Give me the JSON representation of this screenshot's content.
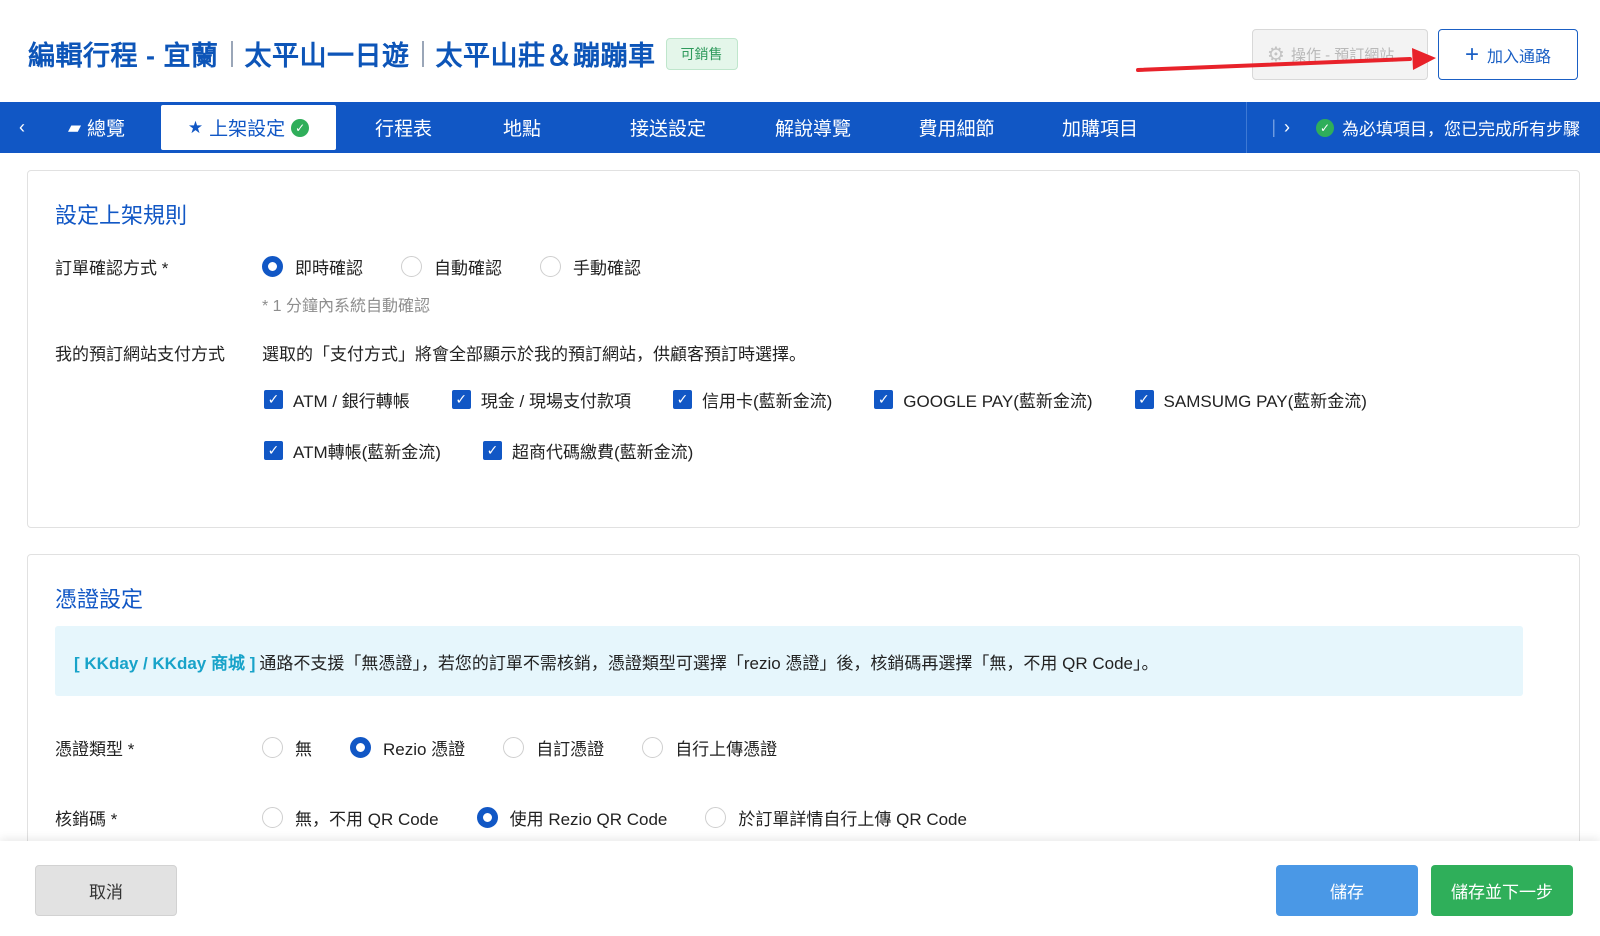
{
  "header": {
    "title_parts": [
      "編輯行程 - 宜蘭",
      "太平山一日遊",
      "太平山莊＆蹦蹦車"
    ],
    "status_badge": "可銷售",
    "op_button_label": "操作 - 預訂網站",
    "add_channel_label": "加入通路"
  },
  "nav": {
    "prev_icon": "chevron-left-icon",
    "next_icon": "chevron-right-icon",
    "tabs": [
      {
        "label": "總覽",
        "icon": "folder-icon"
      },
      {
        "label": "上架設定",
        "icon": "star-icon",
        "active": true,
        "complete": true
      },
      {
        "label": "行程表"
      },
      {
        "label": "地點"
      },
      {
        "label": "接送設定"
      },
      {
        "label": "解說導覽"
      },
      {
        "label": "費用細節"
      },
      {
        "label": "加購項目"
      }
    ],
    "progress_text": "為必填項目，您已完成所有步驟"
  },
  "publish_rules": {
    "title": "設定上架規則",
    "confirm_label": "訂單確認方式 *",
    "confirm_options": [
      "即時確認",
      "自動確認",
      "手動確認"
    ],
    "confirm_selected": "即時確認",
    "confirm_hint": "* 1 分鐘內系統自動確認",
    "payment_label": "我的預訂網站支付方式",
    "payment_desc": "選取的「支付方式」將會全部顯示於我的預訂網站，供顧客預訂時選擇。",
    "payment_row1": [
      "ATM / 銀行轉帳",
      "現金 / 現場支付款項",
      "信用卡(藍新金流)",
      "GOOGLE PAY(藍新金流)",
      "SAMSUMG PAY(藍新金流)"
    ],
    "payment_row2": [
      "ATM轉帳(藍新金流)",
      "超商代碼繳費(藍新金流)"
    ]
  },
  "voucher": {
    "title": "憑證設定",
    "info_tag": "[ KKday / KKday 商城 ]",
    "info_text": "通路不支援「無憑證」，若您的訂單不需核銷，憑證類型可選擇「rezio 憑證」後，核銷碼再選擇「無，不用 QR Code」。",
    "type_label": "憑證類型 *",
    "type_options": [
      "無",
      "Rezio 憑證",
      "自訂憑證",
      "自行上傳憑證"
    ],
    "type_selected": "Rezio 憑證",
    "code_label": "核銷碼 *",
    "code_options": [
      "無，不用 QR Code",
      "使用 Rezio QR Code",
      "於訂單詳情自行上傳 QR Code"
    ],
    "code_selected": "使用 Rezio QR Code"
  },
  "footer": {
    "cancel_label": "取消",
    "save_label": "儲存",
    "save_next_label": "儲存並下一步"
  },
  "colors": {
    "brand_blue": "#1157c5",
    "success_green": "#2faf5a",
    "save_blue": "#4a98e6",
    "annotation_arrow": "#e8222a"
  }
}
